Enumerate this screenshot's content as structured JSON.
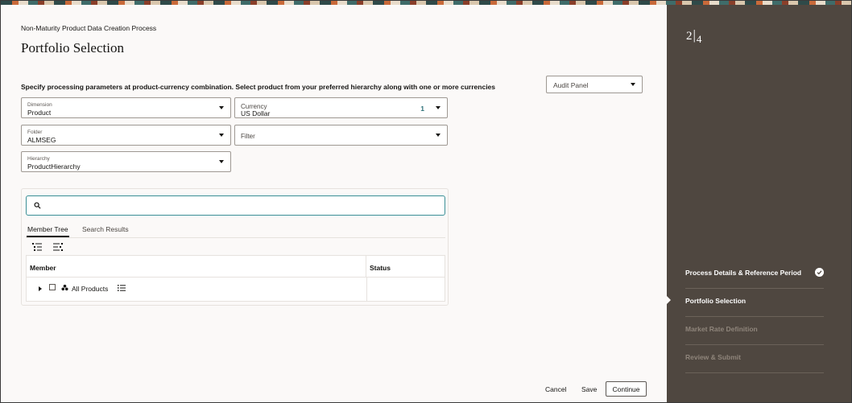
{
  "header": {
    "process_title": "Non-Maturity Product Data Creation Process",
    "page_title": "Portfolio Selection",
    "instructions": "Specify processing parameters at product-currency combination. Select product from your preferred hierarchy along with one or more currencies"
  },
  "audit_panel": {
    "label": "Audit Panel"
  },
  "fields": {
    "dimension": {
      "label": "Dimension",
      "value": "Product"
    },
    "currency": {
      "label": "Currency",
      "value": "US Dollar",
      "count": "1"
    },
    "folder": {
      "label": "Folder",
      "value": "ALMSEG"
    },
    "filter": {
      "placeholder": "Filter"
    },
    "hierarchy": {
      "label": "Hierarchy",
      "value": "ProductHierarchy"
    }
  },
  "search": {
    "placeholder": ""
  },
  "tabs": [
    {
      "label": "Member Tree",
      "active": true
    },
    {
      "label": "Search Results",
      "active": false
    }
  ],
  "table": {
    "columns": [
      "Member",
      "Status"
    ],
    "rows": [
      {
        "member": "All Products",
        "status": ""
      }
    ]
  },
  "footer": {
    "cancel": "Cancel",
    "save": "Save",
    "continue": "Continue"
  },
  "train": {
    "current": "2",
    "total": "4",
    "steps": [
      {
        "label": "Process Details & Reference Period",
        "state": "done"
      },
      {
        "label": "Portfolio Selection",
        "state": "current"
      },
      {
        "label": "Market Rate Definition",
        "state": "todo"
      },
      {
        "label": "Review & Submit",
        "state": "todo"
      }
    ]
  },
  "colors": {
    "sidebar": "#4f4740",
    "accent": "#3a8f96",
    "page": "#fbf9f8"
  }
}
